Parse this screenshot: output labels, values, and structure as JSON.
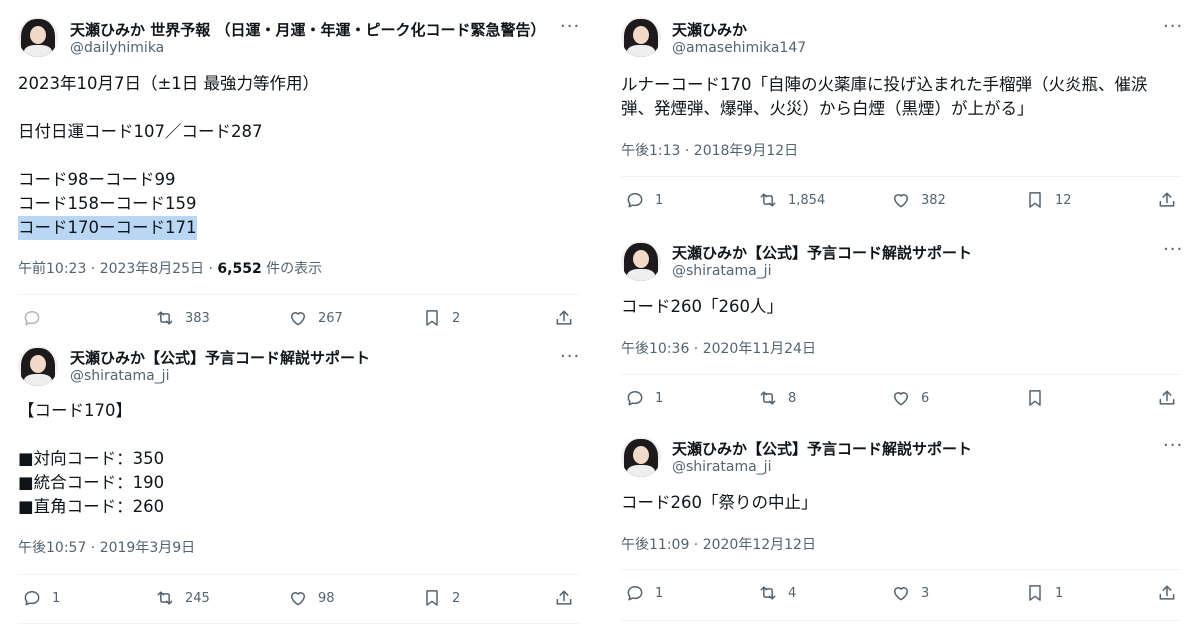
{
  "tweets": [
    {
      "name": "天瀬ひみか 世界予報 （日運・月運・年運・ピーク化コード緊急警告）",
      "handle": "@dailyhimika",
      "line1": "2023年10月7日（±1日 最強力等作用）",
      "line2": "日付日運コード107／コード287",
      "line3": "コード98ーコード99",
      "line4": "コード158ーコード159",
      "line5": "コード170ーコード171",
      "time": "午前10:23 · 2023年8月25日 · ",
      "views": "6,552",
      "views_suffix": " 件の表示",
      "retweets": "383",
      "likes": "267",
      "bookmarks": "2"
    },
    {
      "name": "天瀬ひみか【公式】予言コード解説サポート",
      "handle": "@shiratama_ji",
      "line1": "【コード170】",
      "line2": "■対向コード：350",
      "line3": "■統合コード：190",
      "line4": "■直角コード：260",
      "time": "午後10:57 · 2019年3月9日",
      "replies": "1",
      "retweets": "245",
      "likes": "98",
      "bookmarks": "2"
    },
    {
      "name": "天瀬ひみか",
      "handle": "@amasehimika147",
      "line1": "ルナーコード170「自陣の火薬庫に投げ込まれた手榴弾（火炎瓶、催涙",
      "line2": "弾、発煙弾、爆弾、火災）から白煙（黒煙）が上がる」",
      "time": "午後1:13 · 2018年9月12日",
      "replies": "1",
      "retweets": "1,854",
      "likes": "382",
      "bookmarks": "12"
    },
    {
      "name": "天瀬ひみか【公式】予言コード解説サポート",
      "handle": "@shiratama_ji",
      "line1": "コード260「260人」",
      "time": "午後10:36 · 2020年11月24日",
      "replies": "1",
      "retweets": "8",
      "likes": "6"
    },
    {
      "name": "天瀬ひみか【公式】予言コード解説サポート",
      "handle": "@shiratama_ji",
      "line1": "コード260「祭りの中止」",
      "time": "午後11:09 · 2020年12月12日",
      "replies": "1",
      "retweets": "4",
      "likes": "3",
      "bookmarks": "1"
    }
  ],
  "more_glyph": "···",
  "colors": {
    "highlight": "#b9d7f5",
    "secondary": "#536471",
    "divider": "#eff3f4"
  },
  "icons": [
    "reply-icon",
    "retweet-icon",
    "like-icon",
    "bookmark-icon",
    "share-icon",
    "more-icon"
  ]
}
